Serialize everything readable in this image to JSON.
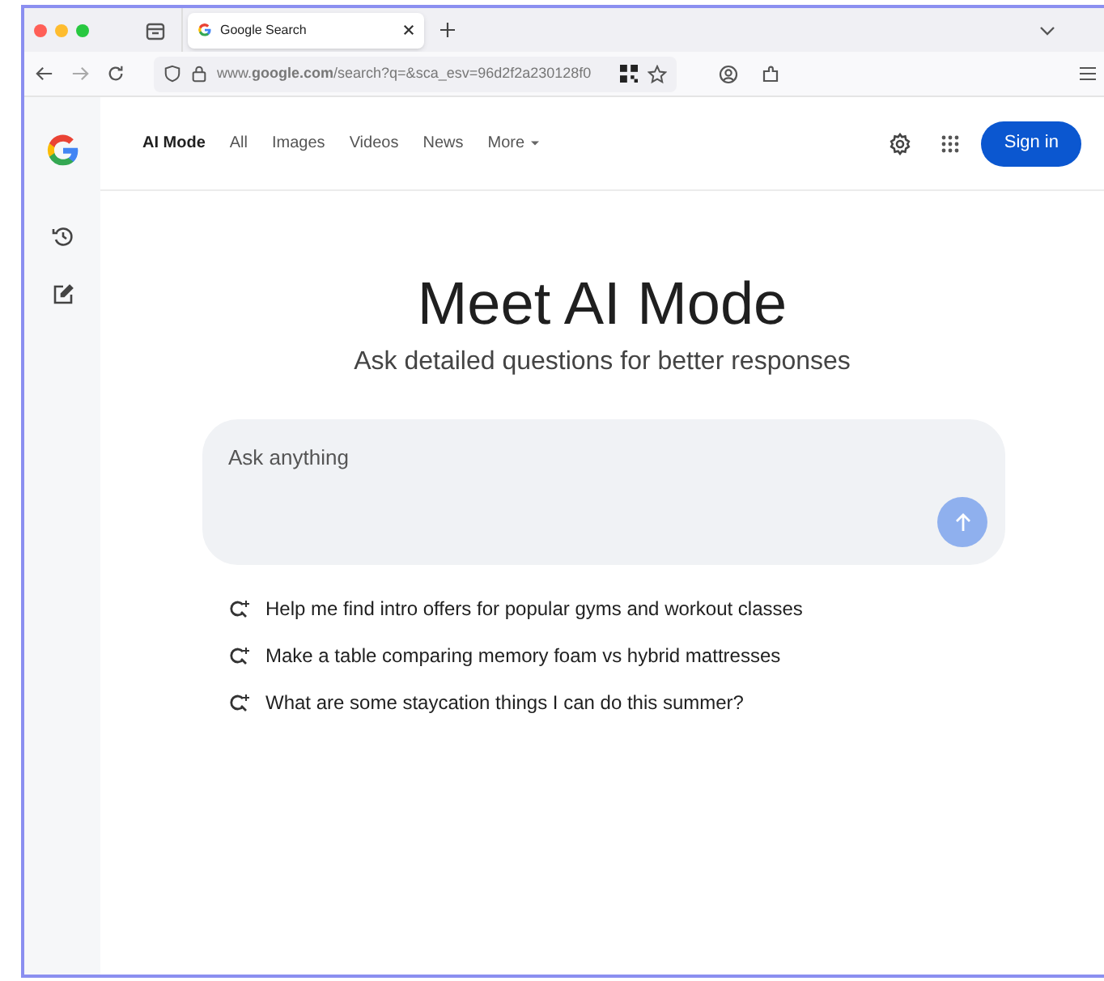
{
  "browser": {
    "tabs": [
      {
        "title": "Google Search",
        "selected": true
      }
    ],
    "url": "www.**google.com**/search?q=&sca_esv=96d2f2a230128f0"
  },
  "nav": {
    "items": [
      {
        "label": "AI Mode",
        "selected": true
      },
      {
        "label": "All",
        "selected": false
      },
      {
        "label": "Images",
        "selected": false
      },
      {
        "label": "Videos",
        "selected": false
      },
      {
        "label": "News",
        "selected": false
      },
      {
        "label": "More",
        "selected": false,
        "dropdown": true
      }
    ],
    "sign_in": "Sign in"
  },
  "hero": {
    "title": "Meet AI Mode",
    "subtitle": "Ask detailed questions for better responses"
  },
  "prompt": {
    "placeholder": "Ask anything"
  },
  "suggestions": [
    "Help me find intro offers for popular gyms and workout classes",
    "Make a table comparing memory foam vs hybrid mattresses",
    "What are some staycation things I can do this summer?"
  ]
}
